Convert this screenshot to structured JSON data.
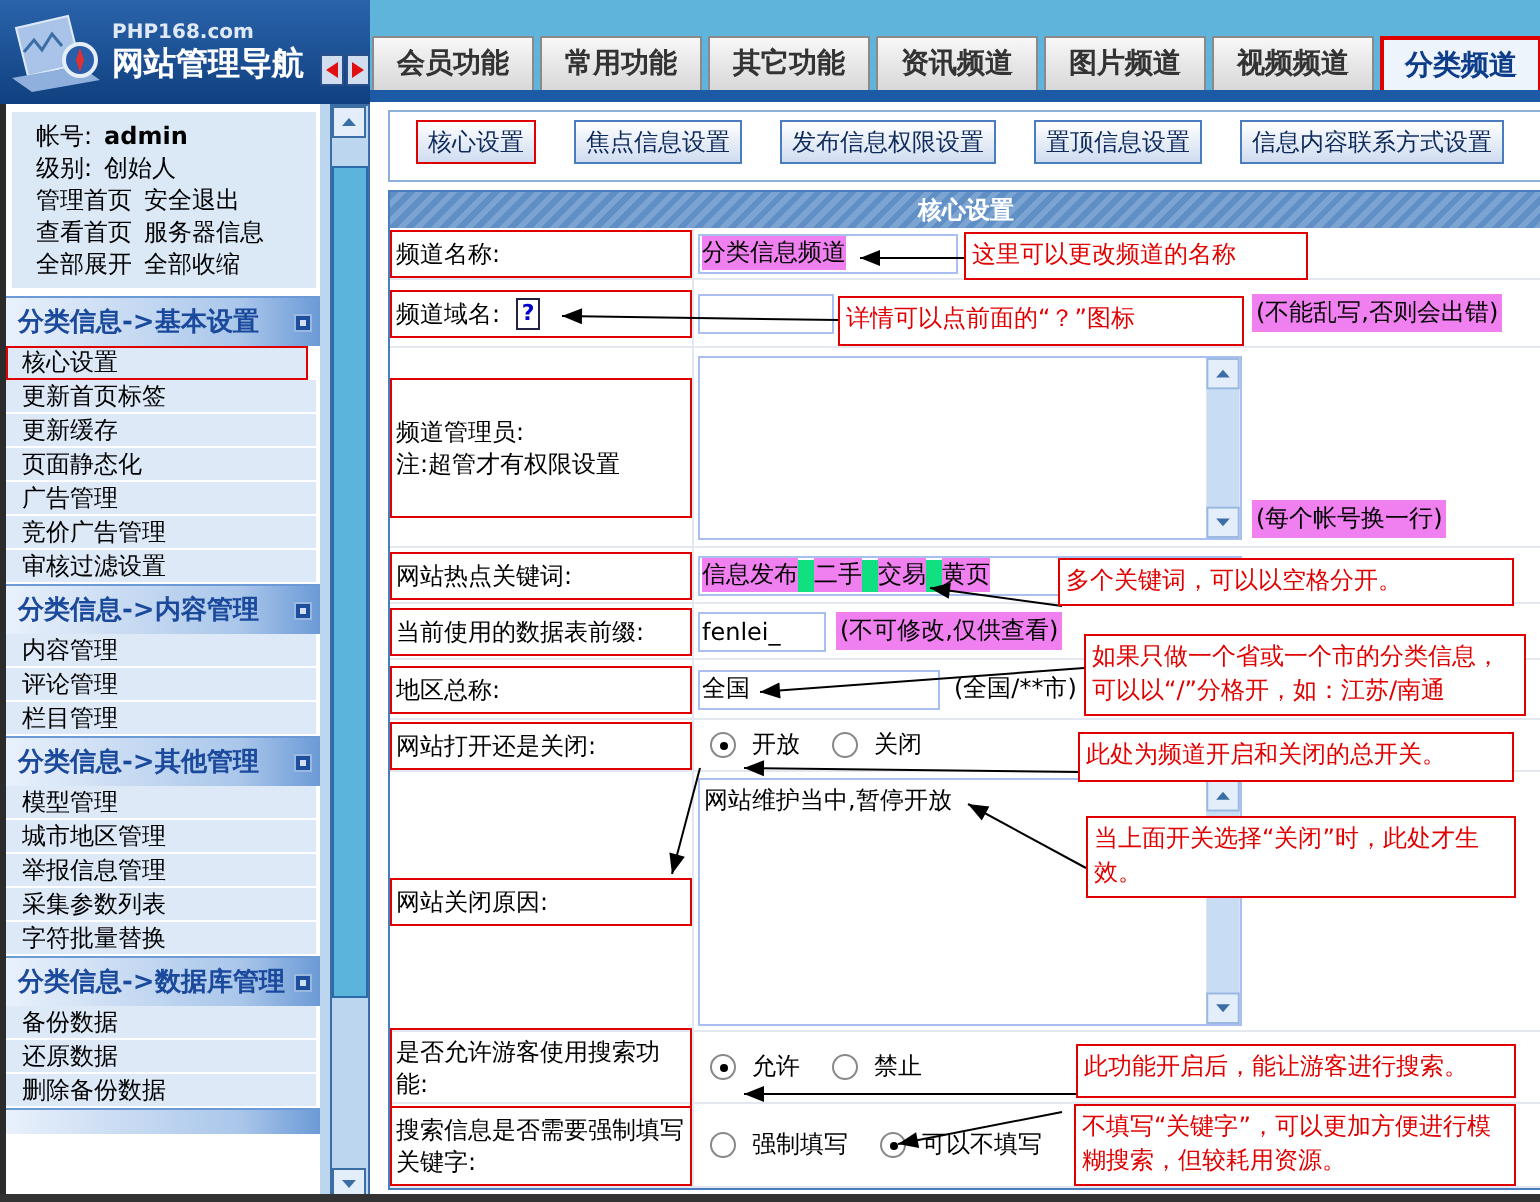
{
  "logo": {
    "domain": "PHP168.com",
    "title": "网站管理导航"
  },
  "tabs": [
    {
      "label": "会员功能",
      "selected": false
    },
    {
      "label": "常用功能",
      "selected": false
    },
    {
      "label": "其它功能",
      "selected": false
    },
    {
      "label": "资讯频道",
      "selected": false
    },
    {
      "label": "图片频道",
      "selected": false
    },
    {
      "label": "视频频道",
      "selected": false
    },
    {
      "label": "分类频道",
      "selected": true
    }
  ],
  "account": {
    "label": "帐号:",
    "value": "admin",
    "rank_label": "级别:",
    "rank": "创始人",
    "links": [
      [
        "管理首页",
        "安全退出"
      ],
      [
        "查看首页",
        "服务器信息"
      ],
      [
        "全部展开",
        "全部收缩"
      ]
    ]
  },
  "sidebar": {
    "groups": [
      {
        "title": "分类信息->基本设置",
        "items": [
          {
            "label": "核心设置",
            "selected": true
          },
          {
            "label": "更新首页标签",
            "selected": false
          },
          {
            "label": "更新缓存",
            "selected": false
          },
          {
            "label": "页面静态化",
            "selected": false
          },
          {
            "label": "广告管理",
            "selected": false
          },
          {
            "label": "竞价广告管理",
            "selected": false
          },
          {
            "label": "审核过滤设置",
            "selected": false
          }
        ]
      },
      {
        "title": "分类信息->内容管理",
        "items": [
          {
            "label": "内容管理",
            "selected": false
          },
          {
            "label": "评论管理",
            "selected": false
          },
          {
            "label": "栏目管理",
            "selected": false
          }
        ]
      },
      {
        "title": "分类信息->其他管理",
        "items": [
          {
            "label": "模型管理",
            "selected": false
          },
          {
            "label": "城市地区管理",
            "selected": false
          },
          {
            "label": "举报信息管理",
            "selected": false
          },
          {
            "label": "采集参数列表",
            "selected": false
          },
          {
            "label": "字符批量替换",
            "selected": false
          }
        ]
      },
      {
        "title": "分类信息->数据库管理",
        "items": [
          {
            "label": "备份数据",
            "selected": false
          },
          {
            "label": "还原数据",
            "selected": false
          },
          {
            "label": "删除备份数据",
            "selected": false
          }
        ]
      }
    ]
  },
  "subtabs": [
    {
      "label": "核心设置",
      "selected": true
    },
    {
      "label": "焦点信息设置",
      "selected": false
    },
    {
      "label": "发布信息权限设置",
      "selected": false
    },
    {
      "label": "置顶信息设置",
      "selected": false
    },
    {
      "label": "信息内容联系方式设置",
      "selected": false
    }
  ],
  "form": {
    "title": "核心设置",
    "rows": [
      {
        "kind": "text",
        "label": "频道名称:",
        "value": "分类信息频道",
        "highlighted": true,
        "annotation": "这里可以更改频道的名称"
      },
      {
        "kind": "text",
        "label": "频道域名:",
        "help_icon": "?",
        "value": "",
        "highlighted": false,
        "note": {
          "text": "(不能乱写,否则会出错)",
          "highlighted": true
        },
        "annotation": "详情可以点前面的“？”图标"
      },
      {
        "kind": "textarea",
        "label": "频道管理员:",
        "sublabel": "注:超管才有权限设置",
        "value": "",
        "note": {
          "text": "(每个帐号换一行)",
          "highlighted": true
        }
      },
      {
        "kind": "keywords",
        "label": "网站热点关键词:",
        "keywords": [
          "信息发布",
          "二手",
          "交易",
          "黄页"
        ],
        "highlighted": true,
        "annotation": "多个关键词，可以以空格分开。"
      },
      {
        "kind": "text",
        "label": "当前使用的数据表前缀:",
        "value": "fenlei_",
        "highlighted": false,
        "note": {
          "text": "(不可修改,仅供查看)",
          "highlighted": true
        }
      },
      {
        "kind": "text",
        "label": "地区总称:",
        "value": "全国",
        "highlighted": false,
        "note": {
          "text": "(全国/**市)",
          "highlighted": false
        },
        "annotation": "如果只做一个省或一个市的分类信息，可以以“/”分格开，如：江苏/南通"
      },
      {
        "kind": "radio",
        "label": "网站打开还是关闭:",
        "options": [
          {
            "label": "开放",
            "selected": true
          },
          {
            "label": "关闭",
            "selected": false
          }
        ],
        "annotation": "此处为频道开启和关闭的总开关。"
      },
      {
        "kind": "textarea",
        "label": "网站关闭原因:",
        "value": "网站维护当中,暂停开放",
        "annotation": "当上面开关选择“关闭”时，此处才生效。"
      },
      {
        "kind": "radio",
        "label": "是否允许游客使用搜索功能:",
        "options": [
          {
            "label": "允许",
            "selected": true
          },
          {
            "label": "禁止",
            "selected": false
          }
        ],
        "annotation": "此功能开启后，能让游客进行搜索。"
      },
      {
        "kind": "radio",
        "label": "搜索信息是否需要强制填写关键字:",
        "options": [
          {
            "label": "强制填写",
            "selected": false
          },
          {
            "label": "可以不填写",
            "selected": true
          }
        ],
        "annotation": "不填写“关键字”，可以更加方便进行模糊搜索，但较耗用资源。"
      }
    ]
  }
}
